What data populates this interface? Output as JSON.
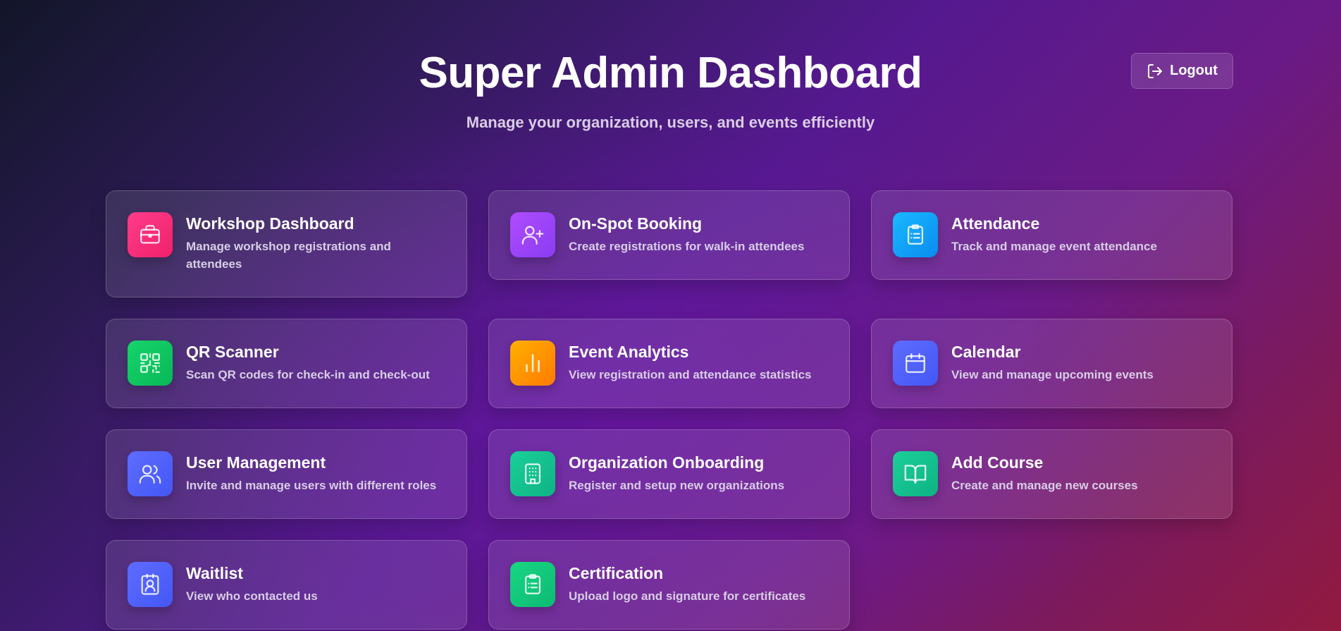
{
  "header": {
    "title": "Super Admin Dashboard",
    "subtitle": "Manage your organization, users, and events efficiently"
  },
  "logout": {
    "label": "Logout",
    "icon": "logout-icon"
  },
  "cards": [
    {
      "title": "Workshop Dashboard",
      "description": "Manage workshop registrations and attendees",
      "icon": "briefcase-icon",
      "color": "#f0206a"
    },
    {
      "title": "On-Spot Booking",
      "description": "Create registrations for walk-in attendees",
      "icon": "user-plus-icon",
      "color": "#8a3cf2"
    },
    {
      "title": "Attendance",
      "description": "Track and manage event attendance",
      "icon": "clipboard-list-icon",
      "color": "#0a8cf0"
    },
    {
      "title": "QR Scanner",
      "description": "Scan QR codes for check-in and check-out",
      "icon": "qr-code-icon",
      "color": "#08b857"
    },
    {
      "title": "Event Analytics",
      "description": "View registration and attendance statistics",
      "icon": "bar-chart-icon",
      "color": "#ff7a00"
    },
    {
      "title": "Calendar",
      "description": "View and manage upcoming events",
      "icon": "calendar-icon",
      "color": "#4457f5"
    },
    {
      "title": "User Management",
      "description": "Invite and manage users with different roles",
      "icon": "users-icon",
      "color": "#4457f5"
    },
    {
      "title": "Organization Onboarding",
      "description": "Register and setup new organizations",
      "icon": "building-icon",
      "color": "#0eb384"
    },
    {
      "title": "Add Course",
      "description": "Create and manage new courses",
      "icon": "book-open-icon",
      "color": "#0eb384"
    },
    {
      "title": "Waitlist",
      "description": "View who contacted us",
      "icon": "contact-icon",
      "color": "#4457f5"
    },
    {
      "title": "Certification",
      "description": "Upload logo and signature for certificates",
      "icon": "clipboard-list-icon",
      "color": "#0dba72"
    }
  ]
}
